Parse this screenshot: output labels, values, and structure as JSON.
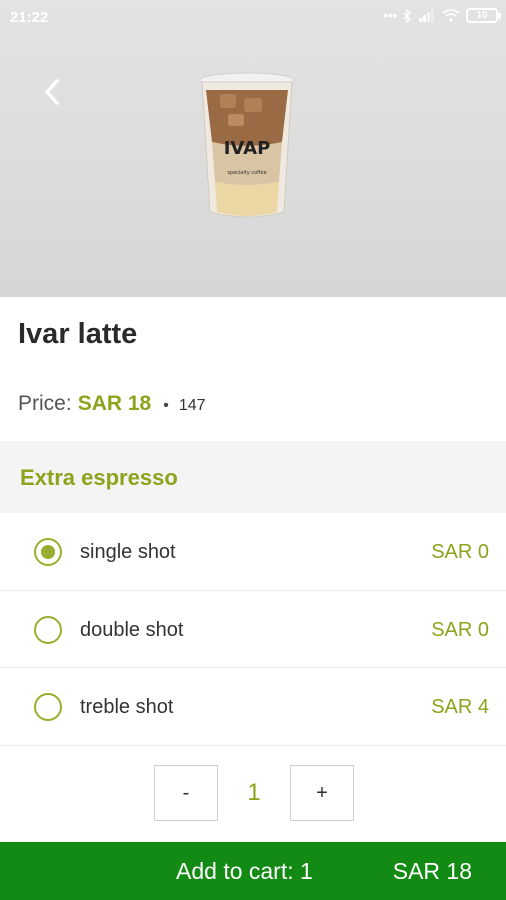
{
  "status_bar": {
    "time": "21:22",
    "battery": "10"
  },
  "product": {
    "name": "Ivar latte",
    "price_label": "Price:",
    "price_value": "SAR 18",
    "separator": "•",
    "count": "147"
  },
  "extras": {
    "title": "Extra espresso",
    "options": [
      {
        "label": "single shot",
        "price": "SAR 0",
        "selected": true
      },
      {
        "label": "double shot",
        "price": "SAR 0",
        "selected": false
      },
      {
        "label": "treble shot",
        "price": "SAR 4",
        "selected": false
      }
    ]
  },
  "quantity": {
    "minus": "-",
    "value": "1",
    "plus": "+"
  },
  "cart": {
    "label": "Add to cart: 1",
    "total": "SAR 18"
  },
  "colors": {
    "accent": "#8da31c",
    "cart_bar": "#138a13"
  },
  "icons": {
    "back": "chevron-left-icon",
    "product_image": "iced-latte-cup"
  }
}
